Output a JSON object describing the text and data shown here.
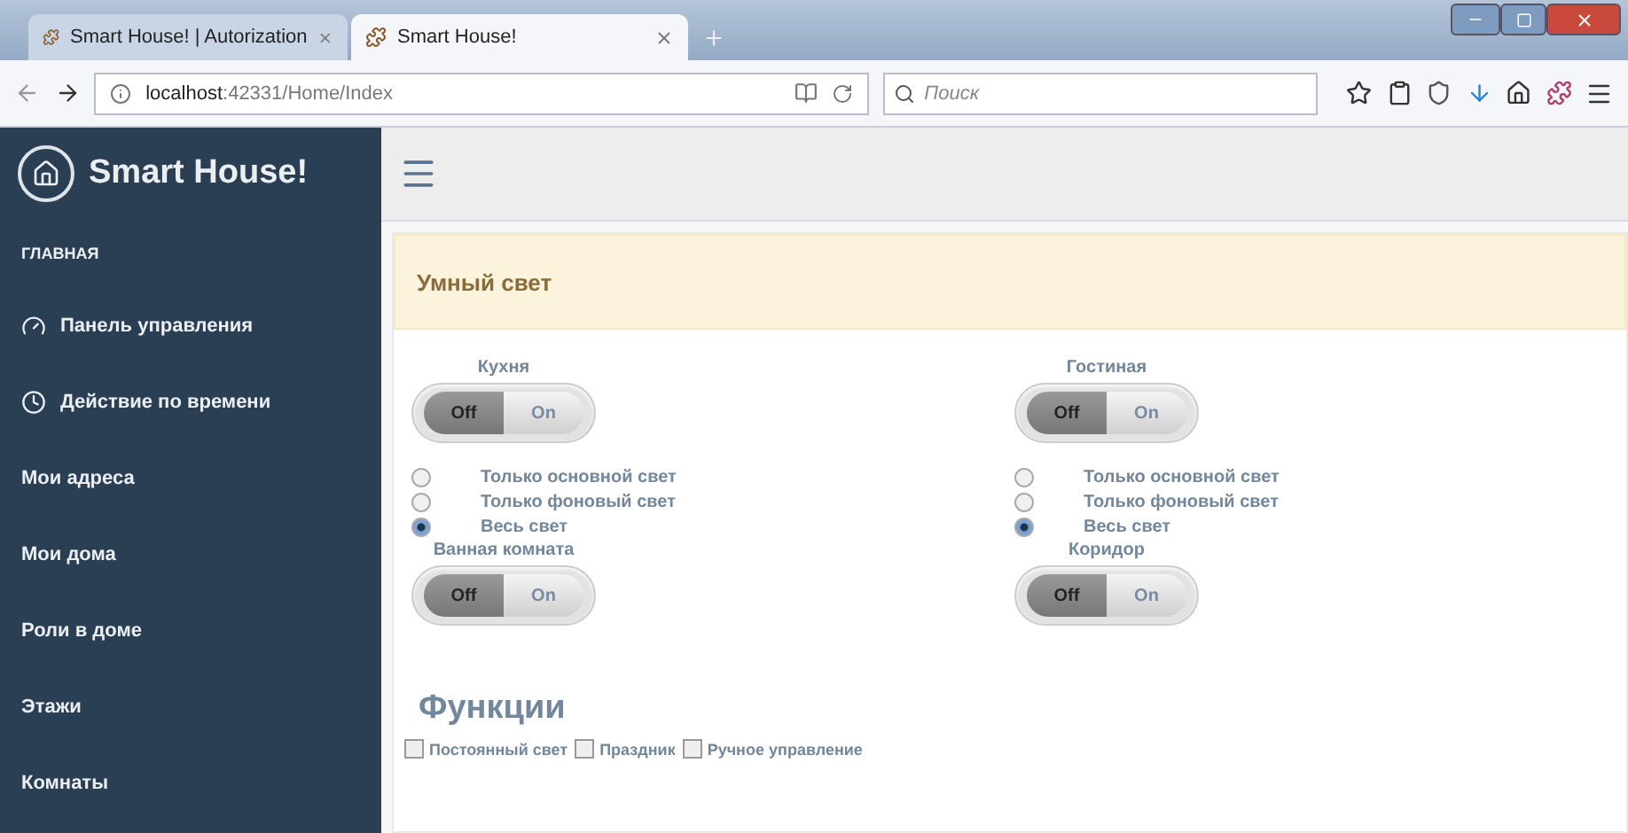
{
  "browser": {
    "tabs": [
      {
        "title": "Smart House! | Autorization",
        "selected": false
      },
      {
        "title": "Smart House!",
        "selected": true
      }
    ],
    "address": "**localhost**:42331/Home/Index",
    "search": {
      "placeholder": "Поиск"
    }
  },
  "sidebar": {
    "brand": "Smart House!",
    "section": "ГЛАВНАЯ",
    "items": [
      {
        "label": "Панель управления"
      },
      {
        "label": "Действие по времени"
      },
      {
        "label": "Мои адреса"
      },
      {
        "label": "Мои дома"
      },
      {
        "label": "Роли в доме"
      },
      {
        "label": "Этажи"
      },
      {
        "label": "Комнаты"
      }
    ]
  },
  "panel": {
    "title": "Умный свет"
  },
  "rooms": [
    {
      "name": "Кухня",
      "off_label": "Off",
      "on_label": "On",
      "on": false,
      "modes": [
        {
          "label": "Только основной свет",
          "selected": false
        },
        {
          "label": "Только фоновый свет",
          "selected": false
        },
        {
          "label": "Весь свет",
          "selected": true
        }
      ]
    },
    {
      "name": "Гостиная",
      "off_label": "Off",
      "on_label": "On",
      "on": false,
      "modes": [
        {
          "label": "Только основной свет",
          "selected": false
        },
        {
          "label": "Только фоновый свет",
          "selected": false
        },
        {
          "label": "Весь свет",
          "selected": true
        }
      ]
    },
    {
      "name": "Ванная комната",
      "off_label": "Off",
      "on_label": "On",
      "on": false
    },
    {
      "name": "Коридор",
      "off_label": "Off",
      "on_label": "On",
      "on": false
    }
  ],
  "functions": {
    "title": "Функции",
    "features": [
      {
        "label": "Постоянный свет",
        "checked": false
      },
      {
        "label": "Праздник",
        "checked": false
      },
      {
        "label": "Ручное управление",
        "checked": false
      }
    ]
  }
}
